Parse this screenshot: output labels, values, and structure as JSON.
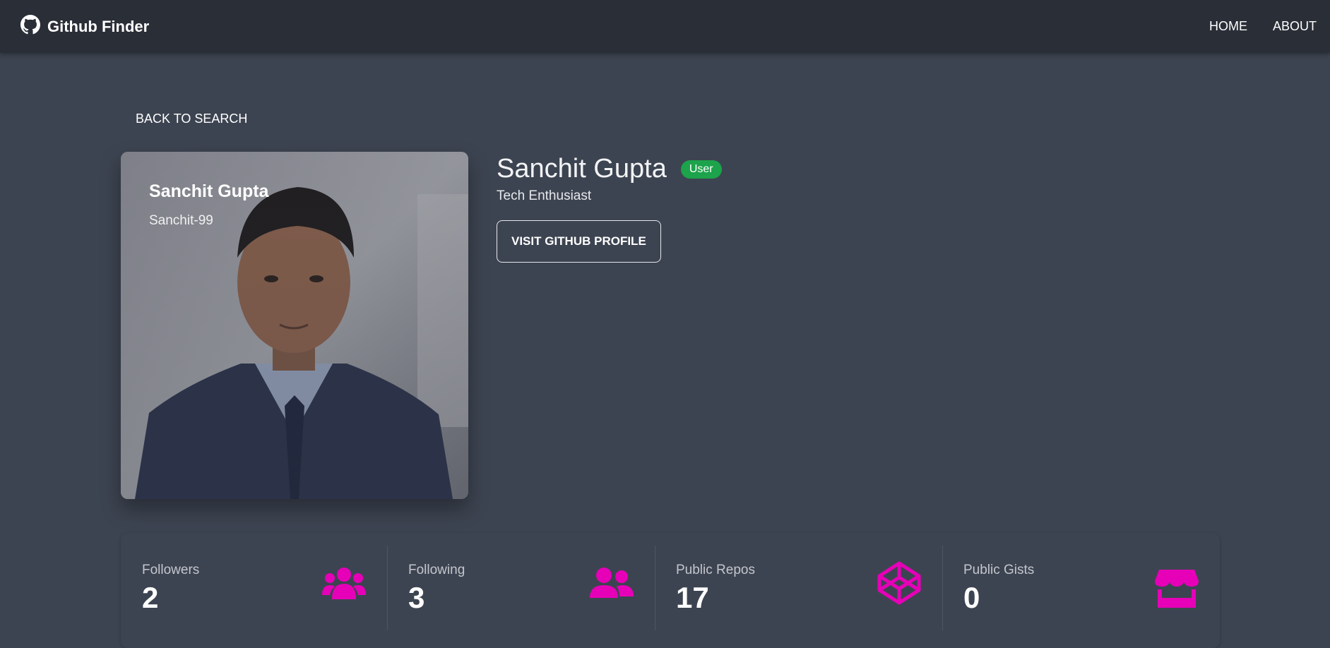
{
  "navbar": {
    "brand": "Github Finder",
    "brand_icon": "github-icon",
    "links": [
      "Home",
      "About"
    ]
  },
  "back_label": "Back to search",
  "card": {
    "name": "Sanchit Gupta",
    "login": "Sanchit-99"
  },
  "profile": {
    "name": "Sanchit Gupta",
    "type": "User",
    "bio": "Tech Enthusiast",
    "visit_label": "Visit Github Profile"
  },
  "stats": [
    {
      "title": "Followers",
      "value": "2",
      "icon": "users-icon"
    },
    {
      "title": "Following",
      "value": "3",
      "icon": "user-friends-icon"
    },
    {
      "title": "Public Repos",
      "value": "17",
      "icon": "codepen-icon"
    },
    {
      "title": "Public Gists",
      "value": "0",
      "icon": "store-icon"
    }
  ],
  "colors": {
    "background": "#3d4451",
    "navbar": "#2a2e37",
    "accent_icon": "#e600b8",
    "badge": "#1ca34b"
  }
}
